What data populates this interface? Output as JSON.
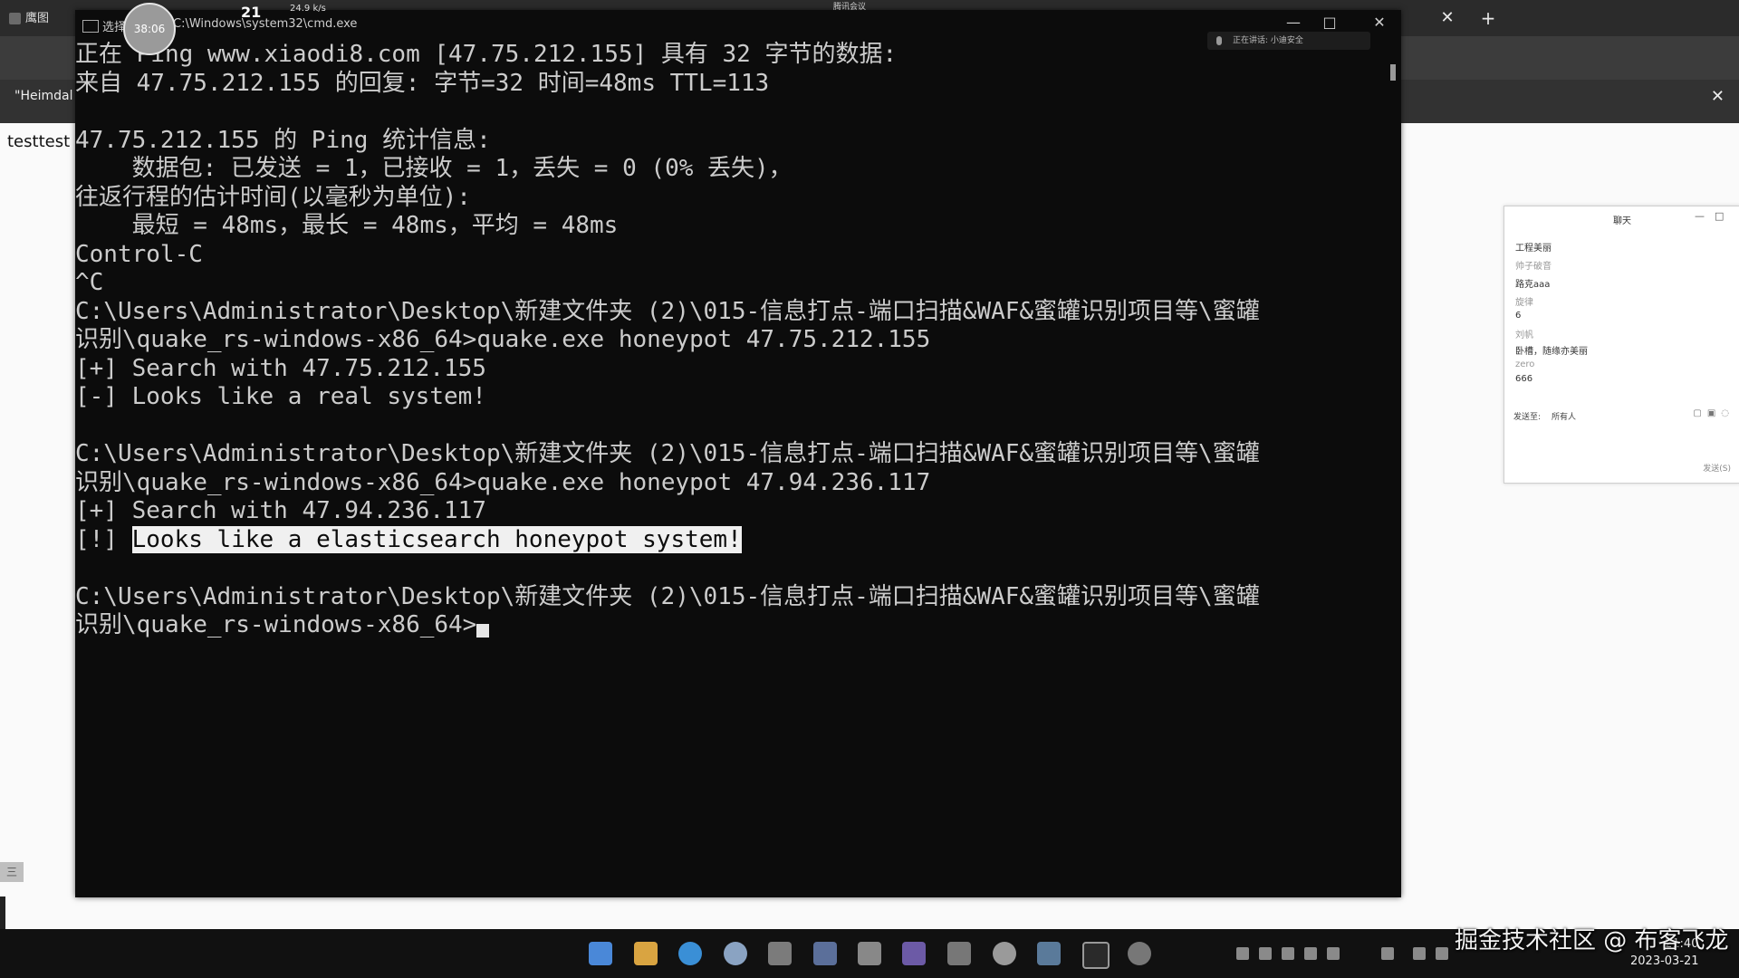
{
  "browser": {
    "tab_title": "鹰图",
    "bookmark": "\"Heimdal",
    "page_text": "testtest",
    "left_badge": "三"
  },
  "recorder": {
    "timer": "38:06",
    "speed_number": "21",
    "speed_text": "24.9 k/s",
    "top_notice": "腾讯会议"
  },
  "cmd": {
    "title": "选择",
    "path": "C:\\Windows\\system32\\cmd.exe",
    "notice": "正在讲话: 小迪安全",
    "lines": [
      "正在 Ping www.xiaodi8.com [47.75.212.155] 具有 32 字节的数据:",
      "来自 47.75.212.155 的回复: 字节=32 时间=48ms TTL=113",
      "",
      "47.75.212.155 的 Ping 统计信息:",
      "    数据包: 已发送 = 1，已接收 = 1，丢失 = 0 (0% 丢失)，",
      "往返行程的估计时间(以毫秒为单位):",
      "    最短 = 48ms，最长 = 48ms，平均 = 48ms",
      "Control-C",
      "^C",
      "C:\\Users\\Administrator\\Desktop\\新建文件夹 (2)\\015-信息打点-端口扫描&WAF&蜜罐识别项目等\\蜜罐",
      "识别\\quake_rs-windows-x86_64>quake.exe honeypot 47.75.212.155",
      "[+] Search with 47.75.212.155",
      "[-] Looks like a real system!",
      "",
      "C:\\Users\\Administrator\\Desktop\\新建文件夹 (2)\\015-信息打点-端口扫描&WAF&蜜罐识别项目等\\蜜罐",
      "识别\\quake_rs-windows-x86_64>quake.exe honeypot 47.94.236.117",
      "[+] Search with 47.94.236.117"
    ],
    "highlight_prefix": "[!] ",
    "highlight_text": "Looks like a elasticsearch honeypot system!",
    "prompt_line1": "C:\\Users\\Administrator\\Desktop\\新建文件夹 (2)\\015-信息打点-端口扫描&WAF&蜜罐识别项目等\\蜜罐",
    "prompt_line2": "识别\\quake_rs-windows-x86_64>"
  },
  "chat": {
    "title": "聊天",
    "lines": [
      "工程美丽",
      "帅子破音",
      "路克aaa",
      "旋律",
      "6",
      "刘帆",
      "卧槽，随缘亦美丽",
      "zero",
      "666"
    ],
    "send_to_label": "发送至:",
    "send_to_value": "所有人",
    "send_button": "发送(S)"
  },
  "taskbar": {
    "time": "21:40",
    "date": "2023-03-21"
  },
  "watermark": "掘金技术社区 @ 布客飞龙"
}
